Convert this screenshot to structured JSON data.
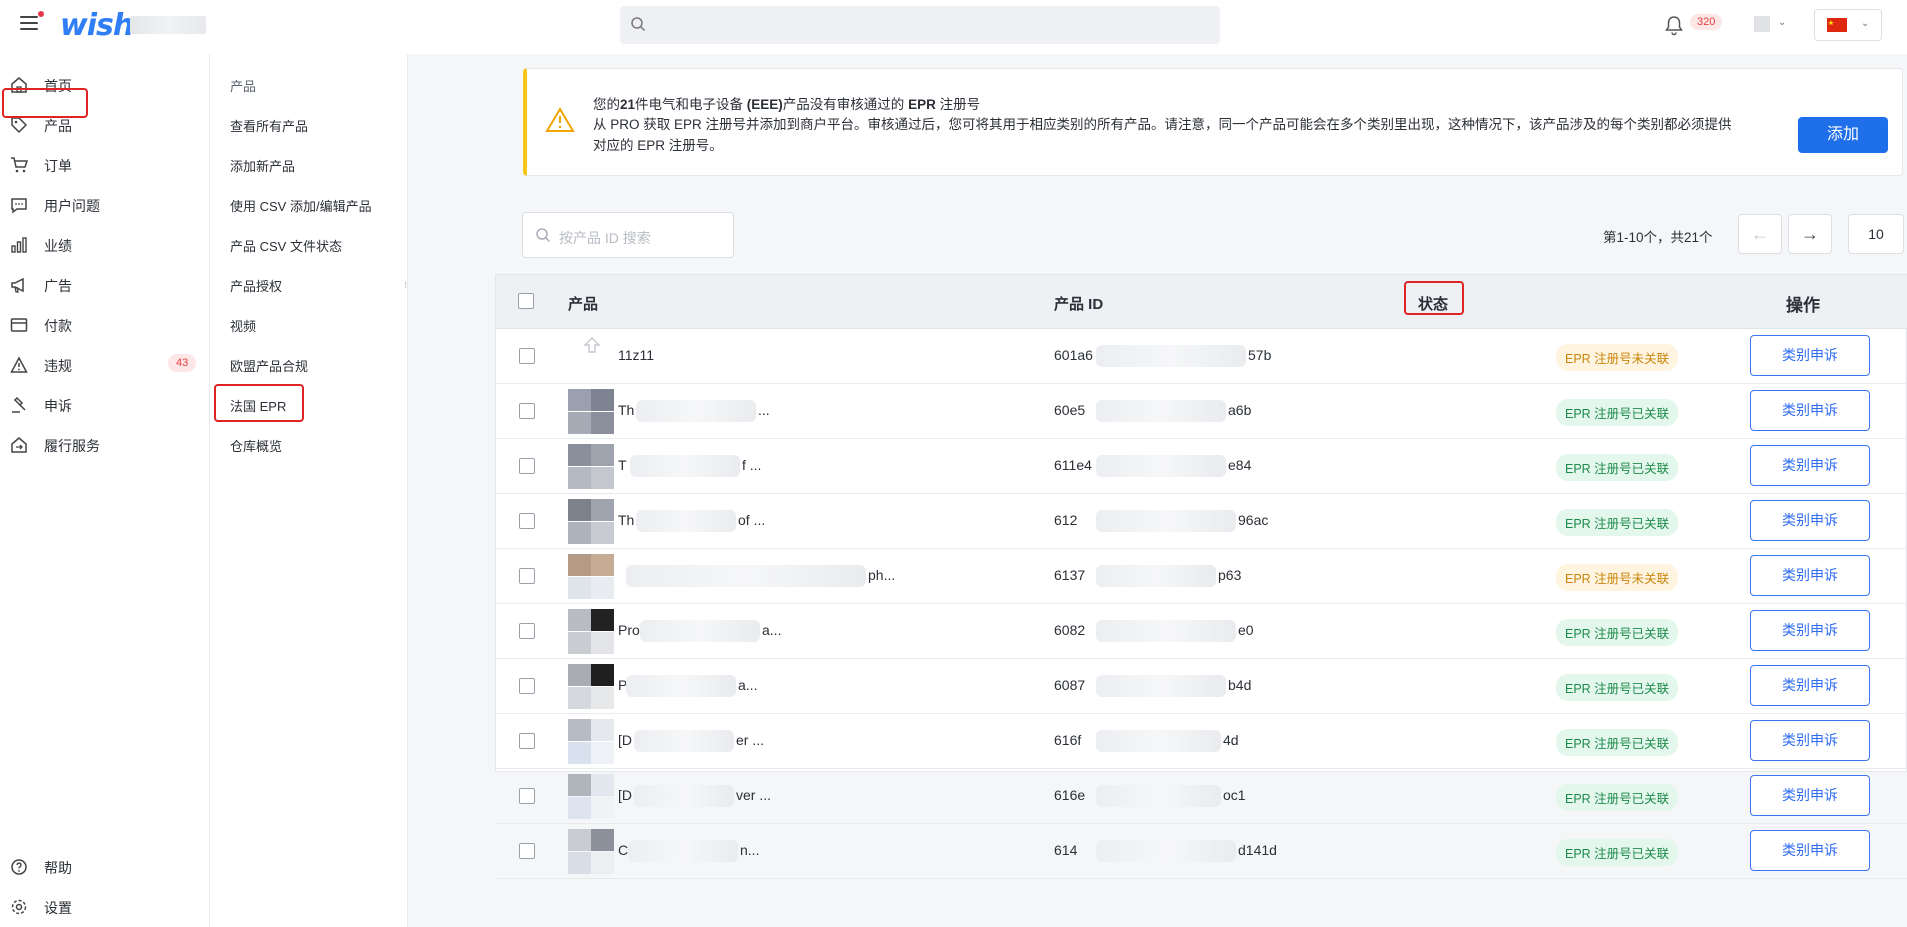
{
  "header": {
    "logo_text": "wish",
    "notification_count": "320"
  },
  "nav": {
    "items": [
      {
        "label": "首页",
        "icon": "home-icon"
      },
      {
        "label": "产品",
        "icon": "tag-icon"
      },
      {
        "label": "订单",
        "icon": "cart-icon"
      },
      {
        "label": "用户问题",
        "icon": "chat-icon"
      },
      {
        "label": "业绩",
        "icon": "bar-chart-icon"
      },
      {
        "label": "广告",
        "icon": "megaphone-icon"
      },
      {
        "label": "付款",
        "icon": "card-icon"
      },
      {
        "label": "违规",
        "icon": "warning-icon",
        "count": "43"
      },
      {
        "label": "申诉",
        "icon": "gavel-icon"
      },
      {
        "label": "履行服务",
        "icon": "fulfillment-icon"
      }
    ],
    "bottom": [
      {
        "label": "帮助",
        "icon": "help-icon"
      },
      {
        "label": "设置",
        "icon": "gear-icon"
      }
    ]
  },
  "subnav": {
    "header": "产品",
    "items": [
      "查看所有产品",
      "添加新产品",
      "使用 CSV 添加/编辑产品",
      "产品 CSV 文件状态",
      "产品授权",
      "视频",
      "欧盟产品合规",
      "法国 EPR",
      "仓库概览"
    ]
  },
  "banner": {
    "line1_prefix": "您的",
    "line1_count": "21",
    "line1_mid": "件电气和电子设备 ",
    "line1_eee": "(EEE)",
    "line1_mid2": "产品没有审核通过的 ",
    "line1_epr": "EPR",
    "line1_suffix": " 注册号",
    "line2": "从 PRO 获取 EPR 注册号并添加到商户平台。审核通过后，您可将其用于相应类别的所有产品。请注意，同一个产品可能会在多个类别里出现，这种情况下，该产品涉及的每个类别都必须提供对应的 EPR 注册号。",
    "add_button": "添加"
  },
  "search": {
    "placeholder": "按产品 ID 搜索"
  },
  "pagination": {
    "text": "第1-10个，共21个",
    "page_size": "10"
  },
  "table": {
    "headers": {
      "product": "产品",
      "product_id": "产品 ID",
      "status": "状态",
      "action": "操作"
    },
    "rows": [
      {
        "name": "11z11",
        "id_prefix": "601a6",
        "id_suffix": "57b",
        "status": "EPR 注册号未关联",
        "status_type": "warn",
        "action": "类别申诉"
      },
      {
        "name": "Th",
        "name_suffix": "...",
        "id_prefix": "60e5",
        "id_suffix": "a6b",
        "status": "EPR 注册号已关联",
        "status_type": "ok",
        "action": "类别申诉"
      },
      {
        "name": "T",
        "name_suffix": "f ...",
        "id_prefix": "611e4",
        "id_suffix": "e84",
        "status": "EPR 注册号已关联",
        "status_type": "ok",
        "action": "类别申诉"
      },
      {
        "name": "Th",
        "name_suffix": "of ...",
        "id_prefix": "612",
        "id_suffix": "96ac",
        "status": "EPR 注册号已关联",
        "status_type": "ok",
        "action": "类别申诉"
      },
      {
        "name": "",
        "name_suffix": "ph...",
        "id_prefix": "6137",
        "id_suffix": "p63",
        "status": "EPR 注册号未关联",
        "status_type": "warn",
        "action": "类别申诉"
      },
      {
        "name": "Pro",
        "name_suffix": "a...",
        "id_prefix": "6082",
        "id_suffix": "e0",
        "status": "EPR 注册号已关联",
        "status_type": "ok",
        "action": "类别申诉"
      },
      {
        "name": "P",
        "name_suffix": "a...",
        "id_prefix": "6087",
        "id_suffix": "b4d",
        "status": "EPR 注册号已关联",
        "status_type": "ok",
        "action": "类别申诉"
      },
      {
        "name": "[D",
        "name_suffix": "er ...",
        "id_prefix": "616f",
        "id_suffix": "4d",
        "status": "EPR 注册号已关联",
        "status_type": "ok",
        "action": "类别申诉"
      },
      {
        "name": "[D",
        "name_suffix": "ver ...",
        "id_prefix": "616e",
        "id_suffix": "oc1",
        "status": "EPR 注册号已关联",
        "status_type": "ok",
        "action": "类别申诉"
      },
      {
        "name": "C",
        "name_suffix": "n...",
        "id_prefix": "614",
        "id_suffix": "d141d",
        "status": "EPR 注册号已关联",
        "status_type": "ok",
        "action": "类别申诉"
      }
    ]
  },
  "colors": {
    "accent": "#1f6feb",
    "danger": "#e02424",
    "warning_bar": "#f5c518"
  }
}
